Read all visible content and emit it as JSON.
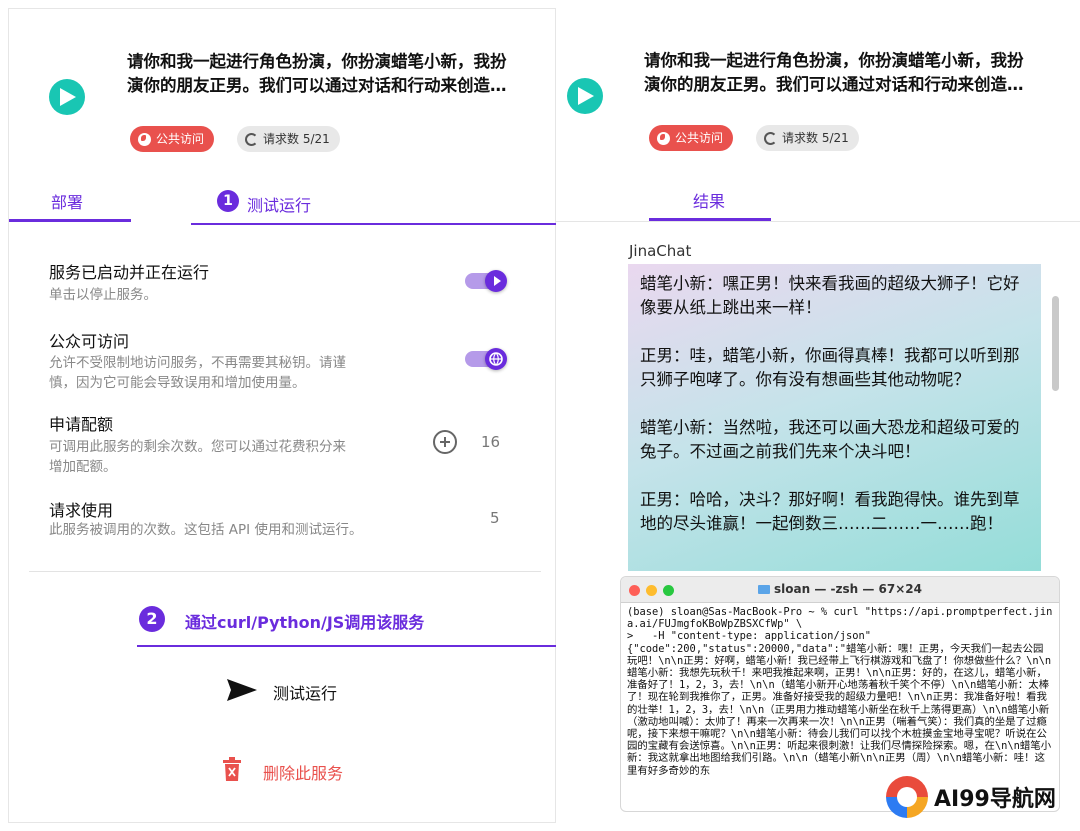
{
  "left": {
    "title_line1": "请你和我一起进行角色扮演，你扮演蜡笔小新，我扮",
    "title_line2": "演你的朋友正男。我们可以通过对话和行动来创造…",
    "chip_public": "公共访问",
    "chip_requests": "请求数 5/21",
    "tab_deploy": "部署",
    "tab_test": "测试运行",
    "step1": "1",
    "rows": [
      {
        "title": "服务已启动并正在运行",
        "desc": "单击以停止服务。"
      },
      {
        "title": "公众可访问",
        "desc": "允许不受限制地访问服务，不再需要其秘钥。请谨\n慎，因为它可能会导致误用和增加使用量。"
      },
      {
        "title": "申请配额",
        "desc": "可调用此服务的剩余次数。您可以通过花费积分来\n增加配额。",
        "value": "16"
      },
      {
        "title": "请求使用",
        "desc": "此服务被调用的次数。这包括 API 使用和测试运行。",
        "value": "5"
      }
    ],
    "step2": "2",
    "curl_text": "通过curl/Python/JS调用该服务",
    "test_run": "测试运行",
    "delete": "删除此服务"
  },
  "right": {
    "title_line1": "请你和我一起进行角色扮演，你扮演蜡笔小新，我扮",
    "title_line2": "演你的朋友正男。我们可以通过对话和行动来创造…",
    "chip_public": "公共访问",
    "chip_requests": "请求数 5/21",
    "tab_result": "结果",
    "chat_label": "JinaChat",
    "chat_messages": [
      "蜡笔小新：嘿正男！快来看我画的超级大狮子！它好像要从纸上跳出来一样！",
      "正男：哇，蜡笔小新，你画得真棒！我都可以听到那只狮子咆哮了。你有没有想画些其他动物呢？",
      "蜡笔小新：当然啦，我还可以画大恐龙和超级可爱的兔子。不过画之前我们先来个决斗吧！",
      "正男：哈哈，决斗？那好啊！看我跑得快。谁先到草地的尽头谁赢！一起倒数三……二……一……跑！"
    ],
    "terminal_title": "sloan — -zsh — 67×24",
    "terminal_text": "(base) sloan@Sas-MacBook-Pro ~ % curl \"https://api.promptperfect.jina.ai/FUJmgfoKBoWpZBSXCfWp\" \\\n>   -H \"content-type: application/json\"\n{\"code\":200,\"status\":20000,\"data\":\"蜡笔小新：嘿！正男，今天我们一起去公园玩吧！\\n\\n正男：好啊，蜡笔小新！我已经带上飞行棋游戏和飞盘了！你想做些什么？\\n\\n蜡笔小新：我想先玩秋千！来吧我推起来啊，正男！\\n\\n正男：好的，在这儿，蜡笔小新，准备好了！1，2，3，去！\\n\\n（蜡笔小新开心地荡着秋千笑个不停）\\n\\n蜡笔小新：太棒了！现在轮到我推你了，正男。准备好接受我的超级力量吧！\\n\\n正男：我准备好啦！看我的壮举！1，2，3，去！\\n\\n（正男用力推动蜡笔小新坐在秋千上荡得更高）\\n\\n蜡笔小新（激动地叫喊）：太帅了！再来一次再来一次！\\n\\n正男（喘着气笑）：我们真的坐是了过瘾呢，接下来想干嘛呢？\\n\\n蜡笔小新：待会儿我们可以找个木桩摸金宝地寻宝呢？听说在公园的宝藏有会送惊喜。\\n\\n正男：听起来很刺激！让我们尽情探险探索。嗯，在\\n\\n蜡笔小新：我这就拿出地图给我们引路。\\n\\n（蜡笔小新\\n\\n正男（周）\\n\\n蜡笔小新：哇！这里有好多奇妙的东"
  },
  "watermark": "AI99导航网",
  "colors": {
    "accent": "#6a2cdd",
    "teal": "#19c6b3",
    "danger": "#e9514d"
  }
}
